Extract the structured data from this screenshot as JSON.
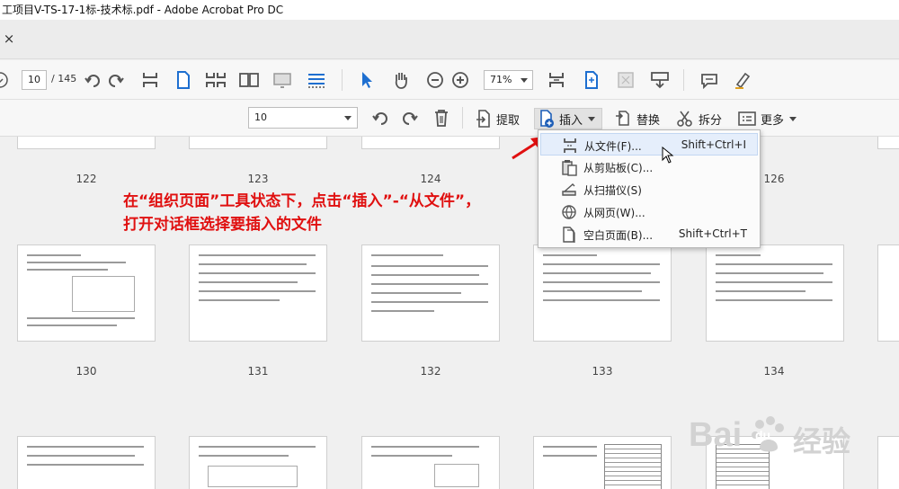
{
  "window": {
    "title": "工项目V-TS-17-1标-技术标.pdf - Adobe Acrobat Pro DC"
  },
  "tabstrip": {
    "close_glyph": "×"
  },
  "nav": {
    "current_page": "10",
    "total_pages": "/ 145",
    "zoom": "71%"
  },
  "organize": {
    "page_select_value": "10",
    "extract_label": "提取",
    "insert_label": "插入",
    "replace_label": "替换",
    "split_label": "拆分",
    "more_label": "更多"
  },
  "insert_menu": {
    "items": [
      {
        "label": "从文件(F)...",
        "shortcut": "Shift+Ctrl+I",
        "icon": "insert-file-icon"
      },
      {
        "label": "从剪贴板(C)...",
        "shortcut": "",
        "icon": "clipboard-icon"
      },
      {
        "label": "从扫描仪(S)",
        "shortcut": "",
        "icon": "scanner-icon"
      },
      {
        "label": "从网页(W)...",
        "shortcut": "",
        "icon": "web-page-icon"
      },
      {
        "label": "空白页面(B)...",
        "shortcut": "Shift+Ctrl+T",
        "icon": "blank-page-icon"
      }
    ]
  },
  "annotation": {
    "line1": "在“组织页面”工具状态下，点击“插入”-“从文件”，",
    "line2": "打开对话框选择要插入的文件",
    "color": "#e01010"
  },
  "pages": {
    "row1_numbers": [
      "122",
      "123",
      "124",
      "126"
    ],
    "row2_numbers": [
      "130",
      "131",
      "132",
      "133",
      "134"
    ]
  },
  "watermark": {
    "brand": "Bai",
    "brand2": "du",
    "cn": "经验"
  }
}
